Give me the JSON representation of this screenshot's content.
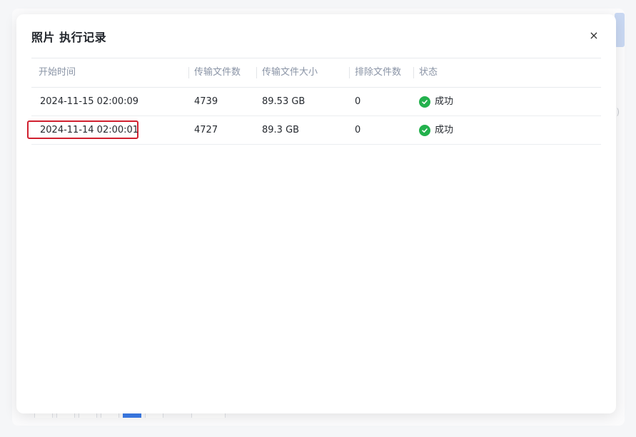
{
  "dialog": {
    "title": "照片 执行记录",
    "close_symbol": "×"
  },
  "table": {
    "columns": [
      "开始时间",
      "传输文件数",
      "传输文件大小",
      "排除文件数",
      "状态"
    ],
    "rows": [
      {
        "start_time": "2024-11-15 02:00:09",
        "file_count": "4739",
        "file_size": "89.53 GB",
        "excluded": "0",
        "status": "成功"
      },
      {
        "start_time": "2024-11-14 02:00:01",
        "file_count": "4727",
        "file_size": "89.3 GB",
        "excluded": "0",
        "status": "成功"
      }
    ]
  },
  "colors": {
    "success": "#23b14d",
    "highlight": "#d0202f",
    "accent": "#3b7be8"
  },
  "icons": {
    "status": "check-circle-icon",
    "close": "close-icon"
  }
}
